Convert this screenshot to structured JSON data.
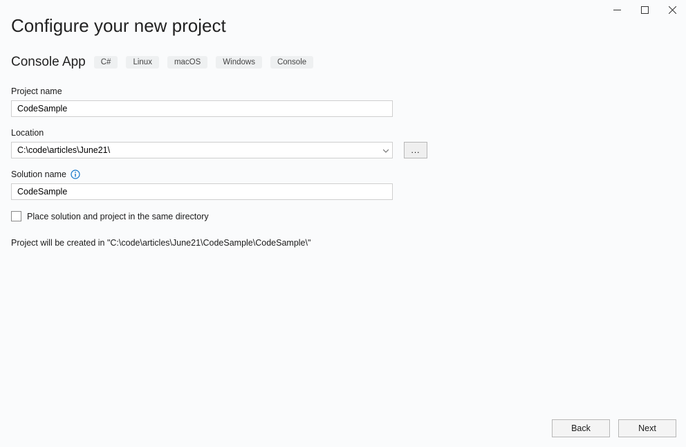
{
  "page": {
    "title": "Configure your new project",
    "template_name": "Console App",
    "tags": [
      "C#",
      "Linux",
      "macOS",
      "Windows",
      "Console"
    ]
  },
  "fields": {
    "project_name": {
      "label": "Project name",
      "value": "CodeSample"
    },
    "location": {
      "label": "Location",
      "value": "C:\\code\\articles\\June21\\",
      "browse_label": "..."
    },
    "solution_name": {
      "label": "Solution name",
      "value": "CodeSample"
    },
    "same_directory": {
      "label": "Place solution and project in the same directory",
      "checked": false
    }
  },
  "summary": "Project will be created in \"C:\\code\\articles\\June21\\CodeSample\\CodeSample\\\"",
  "footer": {
    "back": "Back",
    "next": "Next"
  }
}
